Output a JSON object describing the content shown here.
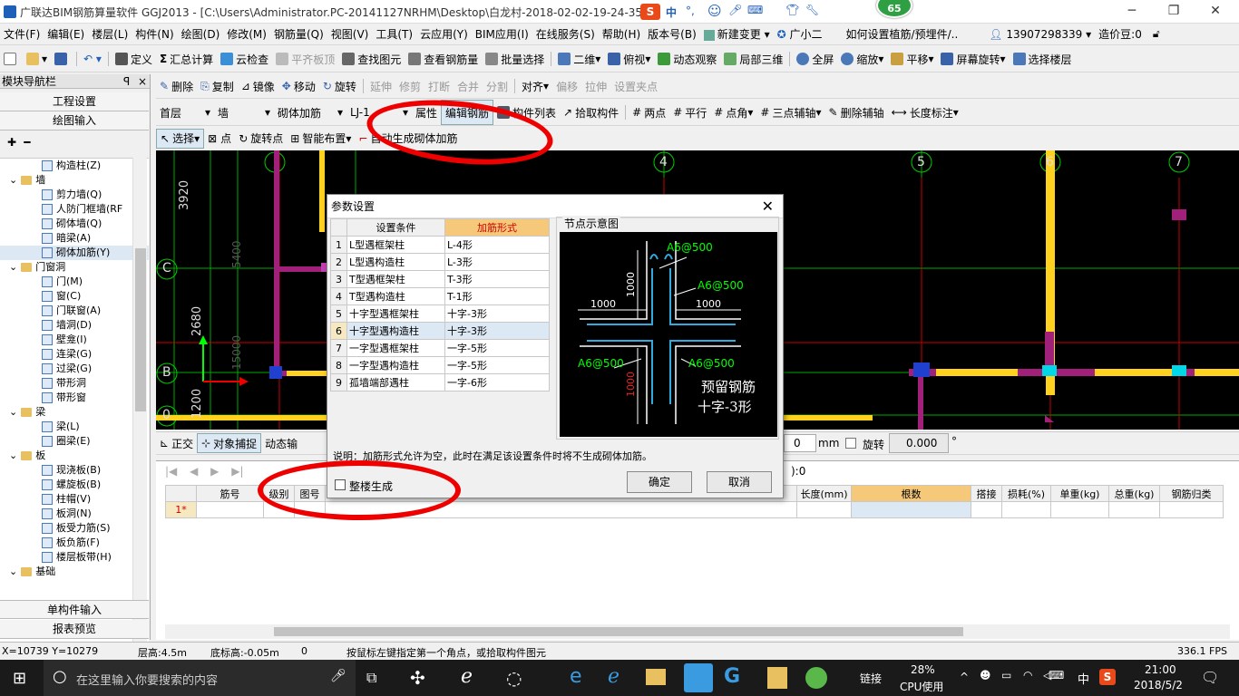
{
  "window": {
    "title": "广联达BIM钢筋算量软件 GGJ2013 - [C:\\Users\\Administrator.PC-20141127NRHM\\Desktop\\白龙村-2018-02-02-19-24-35",
    "badge": "65"
  },
  "ime": {
    "lang": "中",
    "punct": "°,"
  },
  "menu": [
    "文件(F)",
    "编辑(E)",
    "楼层(L)",
    "构件(N)",
    "绘图(D)",
    "修改(M)",
    "钢筋量(Q)",
    "视图(V)",
    "工具(T)",
    "云应用(Y)",
    "BIM应用(I)",
    "在线服务(S)",
    "帮助(H)",
    "版本号(B)",
    "新建变更",
    "广小二",
    "如何设置植筋/预埋件/..",
    "13907298339",
    "造价豆:0"
  ],
  "toolbar1": [
    "定义",
    "汇总计算",
    "云检查",
    "平齐板顶",
    "查找图元",
    "查看钢筋量",
    "批量选择",
    "二维",
    "俯视",
    "动态观察",
    "局部三维",
    "全屏",
    "缩放",
    "平移",
    "屏幕旋转",
    "选择楼层"
  ],
  "toolbar2": [
    "删除",
    "复制",
    "镜像",
    "移动",
    "旋转",
    "延伸",
    "修剪",
    "打断",
    "合并",
    "分割",
    "对齐",
    "偏移",
    "拉伸",
    "设置夹点"
  ],
  "toolbar3": {
    "floor": "首层",
    "category": "墙",
    "type": "砌体加筋",
    "item": "LJ-1",
    "buttons": [
      "属性",
      "编辑钢筋",
      "构件列表",
      "拾取构件",
      "两点",
      "平行",
      "点角",
      "三点辅轴",
      "删除辅轴",
      "长度标注"
    ]
  },
  "toolbar4": [
    "选择",
    "点",
    "旋转点",
    "智能布置",
    "自动生成砌体加筋"
  ],
  "nav": {
    "title": "模块导航栏",
    "pin": "ꟼ",
    "close": "×",
    "sections": [
      "工程设置",
      "绘图输入"
    ],
    "bottom": [
      "单构件输入",
      "报表预览"
    ],
    "tree": [
      {
        "label": "构造柱(Z)",
        "level": 2,
        "type": "item"
      },
      {
        "label": "墙",
        "level": 1,
        "type": "folder"
      },
      {
        "label": "剪力墙(Q)",
        "level": 2,
        "type": "item"
      },
      {
        "label": "人防门框墙(RF",
        "level": 2,
        "type": "item"
      },
      {
        "label": "砌体墙(Q)",
        "level": 2,
        "type": "item"
      },
      {
        "label": "暗梁(A)",
        "level": 2,
        "type": "item"
      },
      {
        "label": "砌体加筋(Y)",
        "level": 2,
        "type": "item",
        "selected": true
      },
      {
        "label": "门窗洞",
        "level": 1,
        "type": "folder"
      },
      {
        "label": "门(M)",
        "level": 2,
        "type": "item"
      },
      {
        "label": "窗(C)",
        "level": 2,
        "type": "item"
      },
      {
        "label": "门联窗(A)",
        "level": 2,
        "type": "item"
      },
      {
        "label": "墙洞(D)",
        "level": 2,
        "type": "item"
      },
      {
        "label": "壁龛(I)",
        "level": 2,
        "type": "item"
      },
      {
        "label": "连梁(G)",
        "level": 2,
        "type": "item"
      },
      {
        "label": "过梁(G)",
        "level": 2,
        "type": "item"
      },
      {
        "label": "带形洞",
        "level": 2,
        "type": "item"
      },
      {
        "label": "带形窗",
        "level": 2,
        "type": "item"
      },
      {
        "label": "梁",
        "level": 1,
        "type": "folder"
      },
      {
        "label": "梁(L)",
        "level": 2,
        "type": "item"
      },
      {
        "label": "圈梁(E)",
        "level": 2,
        "type": "item"
      },
      {
        "label": "板",
        "level": 1,
        "type": "folder"
      },
      {
        "label": "现浇板(B)",
        "level": 2,
        "type": "item"
      },
      {
        "label": "螺旋板(B)",
        "level": 2,
        "type": "item"
      },
      {
        "label": "柱帽(V)",
        "level": 2,
        "type": "item"
      },
      {
        "label": "板洞(N)",
        "level": 2,
        "type": "item"
      },
      {
        "label": "板受力筋(S)",
        "level": 2,
        "type": "item"
      },
      {
        "label": "板负筋(F)",
        "level": 2,
        "type": "item"
      },
      {
        "label": "楼层板带(H)",
        "level": 2,
        "type": "item"
      },
      {
        "label": "基础",
        "level": 1,
        "type": "folder"
      }
    ]
  },
  "canvas": {
    "axis_numbers": [
      "4",
      "5",
      "6",
      "7"
    ],
    "axis_letters": [
      "C",
      "B",
      "0"
    ],
    "dims": [
      "3920",
      "2680",
      "1200"
    ],
    "faint": [
      "5400",
      "15000"
    ]
  },
  "dialog": {
    "title": "参数设置",
    "col_condition": "设置条件",
    "col_form": "加筋形式",
    "rows": [
      {
        "n": "1",
        "cond": "L型遇框架柱",
        "form": "L-4形"
      },
      {
        "n": "2",
        "cond": "L型遇构造柱",
        "form": "L-3形"
      },
      {
        "n": "3",
        "cond": "T型遇框架柱",
        "form": "T-3形"
      },
      {
        "n": "4",
        "cond": "T型遇构造柱",
        "form": "T-1形"
      },
      {
        "n": "5",
        "cond": "十字型遇框架柱",
        "form": "十字-3形"
      },
      {
        "n": "6",
        "cond": "十字型遇构造柱",
        "form": "十字-3形",
        "selected": true
      },
      {
        "n": "7",
        "cond": "一字型遇框架柱",
        "form": "一字-5形"
      },
      {
        "n": "8",
        "cond": "一字型遇构造柱",
        "form": "一字-5形"
      },
      {
        "n": "9",
        "cond": "孤墙端部遇柱",
        "form": "一字-6形"
      }
    ],
    "preview_title": "节点示意图",
    "preview": {
      "rebar": "A6@500",
      "len": "1000",
      "caption1": "预留钢筋",
      "caption2": "十字-3形"
    },
    "note": "说明：加筋形式允许为空，此时在满足该设置条件时将不生成砌体加筋。",
    "whole_building_label": "整楼生成",
    "ok": "确定",
    "cancel": "取消"
  },
  "snapbar": {
    "ortho": "正交",
    "snap": "对象捕捉",
    "dynamic": "动态输",
    "unit": "mm",
    "rotate": "旋转",
    "rotate_value": "0.000",
    "deg": "°",
    "len_value": "0"
  },
  "grid": {
    "headers": [
      "筋号",
      "级别",
      "图号",
      "长度(mm)",
      "根数",
      "搭接",
      "损耗(%)",
      "单重(kg)",
      "总重(kg)",
      "钢筋归类"
    ],
    "row1": "1*",
    "hint": "):0"
  },
  "status": {
    "coords": "X=10739 Y=10279",
    "floor_height": "层高:4.5m",
    "bottom_elev": "底标高:-0.05m",
    "zero": "0",
    "hint": "按鼠标左键指定第一个角点，或拾取构件图元",
    "fps": "336.1 FPS"
  },
  "taskbar": {
    "search_placeholder": "在这里输入你要搜索的内容",
    "link": "链接",
    "cpu_pct": "28%",
    "cpu_label": "CPU使用",
    "ime": "中",
    "time": "21:00",
    "date": "2018/5/2"
  }
}
